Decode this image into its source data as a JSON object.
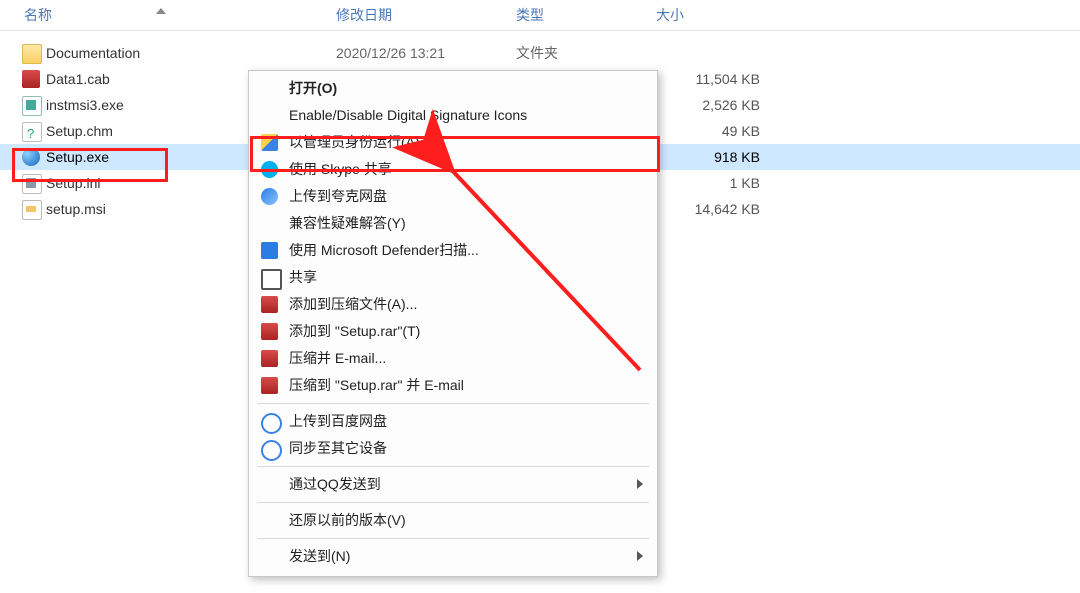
{
  "columns": {
    "name": "名称",
    "date": "修改日期",
    "type": "类型",
    "size": "大小"
  },
  "files": [
    {
      "name": "Documentation",
      "date": "2020/12/26 13:21",
      "type": "文件夹",
      "size": "",
      "icon": "ic-folder"
    },
    {
      "name": "Data1.cab",
      "date": "",
      "type": "",
      "size": "11,504 KB",
      "icon": "ic-cab"
    },
    {
      "name": "instmsi3.exe",
      "date": "",
      "type": "",
      "size": "2,526 KB",
      "icon": "ic-exe"
    },
    {
      "name": "Setup.chm",
      "date": "",
      "type": "",
      "size": "49 KB",
      "icon": "ic-chm"
    },
    {
      "name": "Setup.exe",
      "date": "",
      "type": "",
      "size": "918 KB",
      "icon": "ic-globe",
      "selected": true
    },
    {
      "name": "Setup.ini",
      "date": "",
      "type": "",
      "size": "1 KB",
      "icon": "ic-ini"
    },
    {
      "name": "setup.msi",
      "date": "",
      "type": "",
      "size": "14,642 KB",
      "icon": "ic-msi"
    }
  ],
  "context_menu": [
    {
      "kind": "item",
      "label": "打开(O)",
      "bold": true
    },
    {
      "kind": "item",
      "label": "Enable/Disable Digital Signature Icons"
    },
    {
      "kind": "item",
      "label": "以管理员身份运行(A)",
      "icon": "mi-shield"
    },
    {
      "kind": "item",
      "label": "使用 Skype 共享",
      "icon": "mi-skype"
    },
    {
      "kind": "item",
      "label": "上传到夸克网盘",
      "icon": "mi-cloud"
    },
    {
      "kind": "item",
      "label": "兼容性疑难解答(Y)"
    },
    {
      "kind": "item",
      "label": "使用 Microsoft Defender扫描...",
      "icon": "mi-def"
    },
    {
      "kind": "item",
      "label": "共享",
      "icon": "mi-share"
    },
    {
      "kind": "item",
      "label": "添加到压缩文件(A)...",
      "icon": "mi-rar"
    },
    {
      "kind": "item",
      "label": "添加到 \"Setup.rar\"(T)",
      "icon": "mi-rar"
    },
    {
      "kind": "item",
      "label": "压缩并 E-mail...",
      "icon": "mi-rar"
    },
    {
      "kind": "item",
      "label": "压缩到 \"Setup.rar\" 并 E-mail",
      "icon": "mi-rar"
    },
    {
      "kind": "sep"
    },
    {
      "kind": "item",
      "label": "上传到百度网盘",
      "icon": "mi-baidu"
    },
    {
      "kind": "item",
      "label": "同步至其它设备",
      "icon": "mi-baidu"
    },
    {
      "kind": "sep"
    },
    {
      "kind": "item",
      "label": "通过QQ发送到",
      "submenu": true
    },
    {
      "kind": "sep"
    },
    {
      "kind": "item",
      "label": "还原以前的版本(V)"
    },
    {
      "kind": "sep"
    },
    {
      "kind": "item",
      "label": "发送到(N)",
      "submenu": true
    }
  ]
}
